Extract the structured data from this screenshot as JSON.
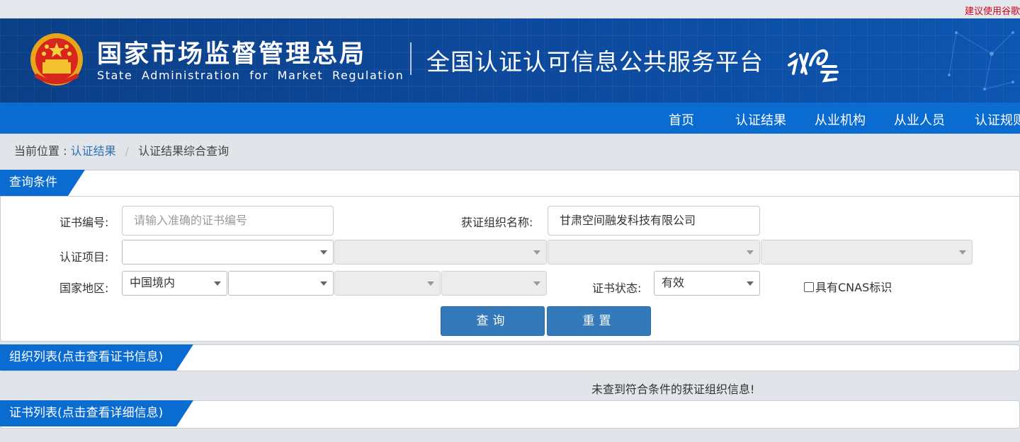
{
  "top_notice": "建议使用谷歌",
  "header": {
    "agency_cn": "国家市场监督管理总局",
    "agency_en": "State Administration for Market Regulation",
    "platform": "全国认证认可信息公共服务平台"
  },
  "nav": {
    "items": [
      "首页",
      "认证结果",
      "从业机构",
      "从业人员",
      "认证规则"
    ]
  },
  "breadcrumb": {
    "label": "当前位置 :",
    "link": "认证结果",
    "separator": "/",
    "current": "认证结果综合查询"
  },
  "query_panel": {
    "title": "查询条件",
    "cert_no_label": "证书编号:",
    "cert_no_placeholder": "请输入准确的证书编号",
    "org_name_label": "获证组织名称:",
    "org_name_value": "甘肃空间融发科技有限公司",
    "project_label": "认证项目:",
    "region_label": "国家地区:",
    "region_value": "中国境内",
    "status_label": "证书状态:",
    "status_value": "有效",
    "cnas_label": "具有CNAS标识",
    "search_button": "查询",
    "reset_button": "重置"
  },
  "org_list": {
    "title": "组织列表(点击查看证书信息)",
    "empty_message": "未查到符合条件的获证组织信息!"
  },
  "cert_list": {
    "title": "证书列表(点击查看详细信息)"
  },
  "colors": {
    "nav_blue": "#0a6bd1",
    "banner_blue": "#0d4a9e",
    "button_blue": "#3479b9",
    "notice_red": "#d0021b"
  }
}
